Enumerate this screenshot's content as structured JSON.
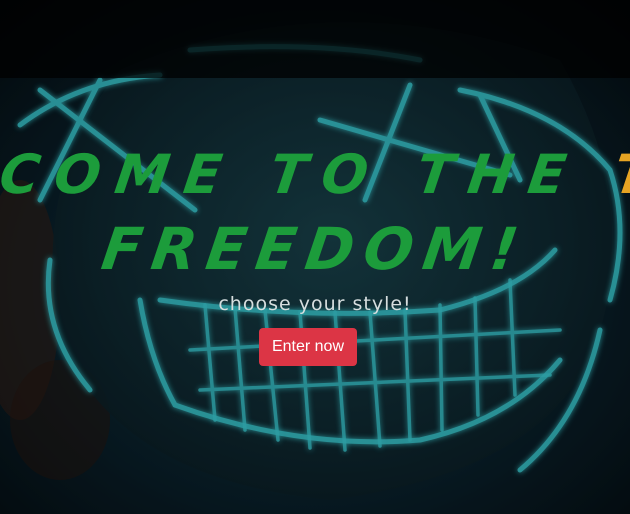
{
  "hero": {
    "headline_line1_part1": "COME TO THE",
    "headline_line1_part2": "TUNES",
    "headline_line2": "FREEDOM!",
    "tagline": "choose your style!",
    "cta_label": "Enter now",
    "background": "neon-purge-mask-photo"
  },
  "colors": {
    "headline_green": "#1c9c3b",
    "headline_orange": "#e7a423",
    "button": "#dc3545",
    "neon": "#3fe0e8"
  }
}
